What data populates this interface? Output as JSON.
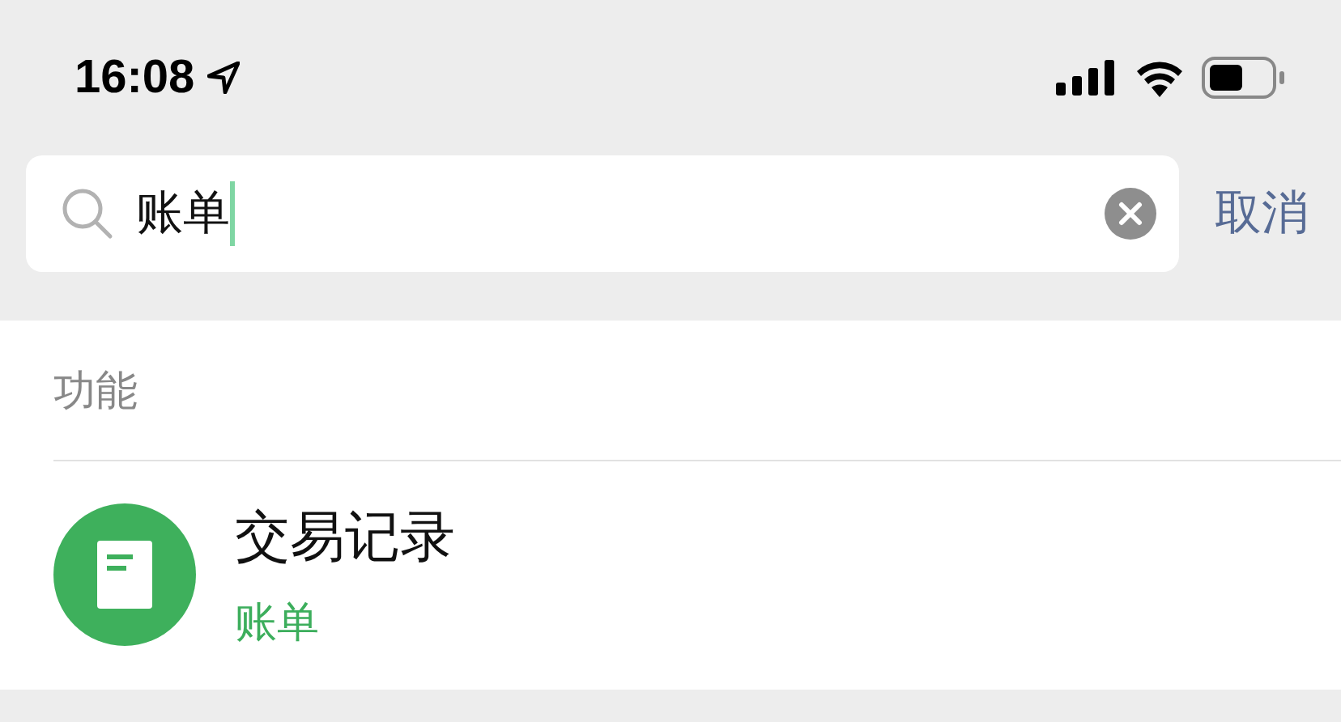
{
  "status_bar": {
    "time": "16:08"
  },
  "search": {
    "value": "账单",
    "cancel": "取消"
  },
  "section": {
    "title": "功能",
    "results": [
      {
        "title": "交易记录",
        "subtitle": "账单"
      }
    ]
  }
}
